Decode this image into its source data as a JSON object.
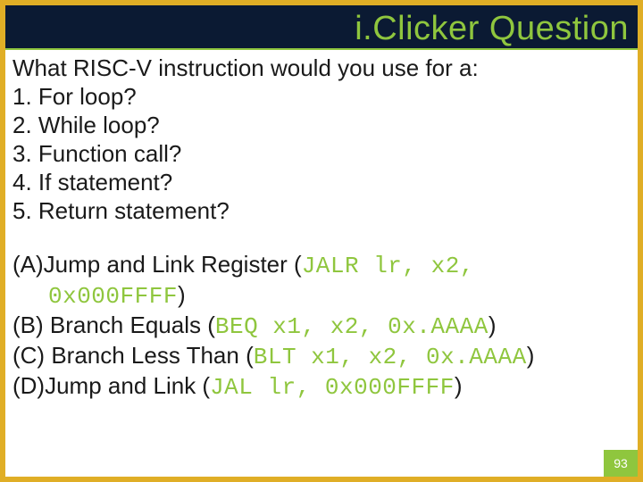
{
  "title": "i.Clicker Question",
  "question": {
    "prompt": "What RISC-V instruction would you use for a:",
    "items": [
      "1. For loop?",
      "2. While loop?",
      "3. Function call?",
      "4. If statement?",
      "5. Return statement?"
    ]
  },
  "answers": {
    "a": {
      "label_pre": "(A)Jump and Link Register (",
      "code1": "JALR lr, x2,",
      "code2": "0x000FFFF",
      "label_post": ")"
    },
    "b": {
      "label_pre": "(B) Branch Equals (",
      "code": "BEQ x1, x2, 0x.AAAA",
      "label_post": ")"
    },
    "c": {
      "label_pre": "(C) Branch Less Than (",
      "code": "BLT x1, x2, 0x.AAAA",
      "label_post": ")"
    },
    "d": {
      "label_pre": "(D)Jump and Link (",
      "code": "JAL lr, 0x000FFFF",
      "label_post": ")"
    }
  },
  "page_number": "93"
}
